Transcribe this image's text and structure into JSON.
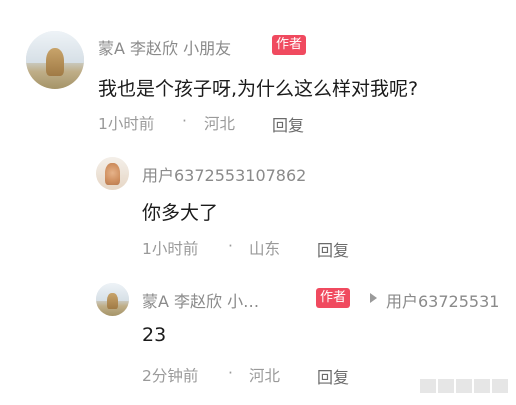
{
  "comment": {
    "author": "蒙A 李赵欣 小朋友",
    "author_tag": "作者",
    "content": "我也是个孩子呀,为什么这么样对我呢?",
    "time": "1小时前",
    "dot": "·",
    "location": "河北",
    "reply_label": "回复"
  },
  "replies": [
    {
      "author": "用户6372553107862",
      "content": "你多大了",
      "time": "1小时前",
      "dot": "·",
      "location": "山东",
      "reply_label": "回复"
    },
    {
      "author": "蒙A 李赵欣 小…",
      "author_tag": "作者",
      "reply_to": "用户63725531",
      "content": "23",
      "time": "2分钟前",
      "dot": "·",
      "location": "河北",
      "reply_label": "回复"
    }
  ],
  "icons": {
    "reply_arrow": "play-arrow-icon"
  },
  "colors": {
    "tag_bg": "#f04a5f",
    "meta_text": "#9a9a9a",
    "body_text": "#1b1b1b"
  }
}
